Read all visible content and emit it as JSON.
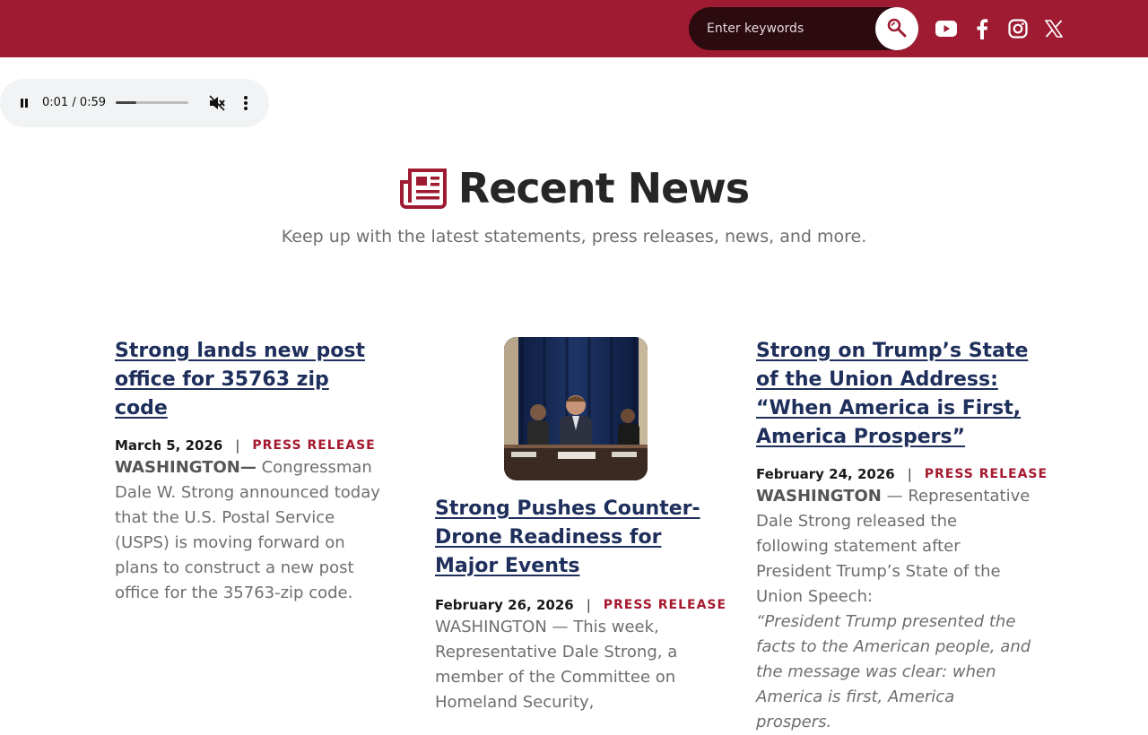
{
  "search": {
    "placeholder": "Enter keywords"
  },
  "social": [
    "youtube-icon",
    "facebook-icon",
    "instagram-icon",
    "x-icon"
  ],
  "player": {
    "time": "0:01 / 0:59",
    "progress": 0.028
  },
  "hero": {
    "title": "Recent News",
    "subtitle": "Keep up with the latest statements, press releases, news, and more."
  },
  "articles": [
    {
      "title": "Strong lands new post office for 35763 zip code",
      "date": "March 5, 2026",
      "tag": "PRESS RELEASE",
      "lead": "WASHINGTON—",
      "body": " Congressman Dale W. Strong announced today that the U.S. Postal Service (USPS) is moving forward on plans to construct a new post office for the 35763-zip code."
    },
    {
      "title": "Strong Pushes Counter-Drone Readiness for Major Events",
      "date": "February 26, 2026",
      "tag": "PRESS RELEASE",
      "body": "WASHINGTON — This week, Representative Dale Strong, a member of the Committee on Homeland Security,"
    },
    {
      "title": "Strong on Trump’s State of the Union Address: “When America is First, America Prospers”",
      "date": "February 24, 2026",
      "tag": "PRESS RELEASE",
      "lead": "WASHINGTON",
      "body": " — Representative Dale Strong released the following statement after President Trump’s State of the Union Speech:",
      "quote": "“President Trump presented the facts to the American people, and the message was clear: when America is first, America prospers."
    }
  ],
  "colors": {
    "brand": "#9e1b32",
    "link": "#1f2f5c",
    "tag": "#a5182e"
  }
}
